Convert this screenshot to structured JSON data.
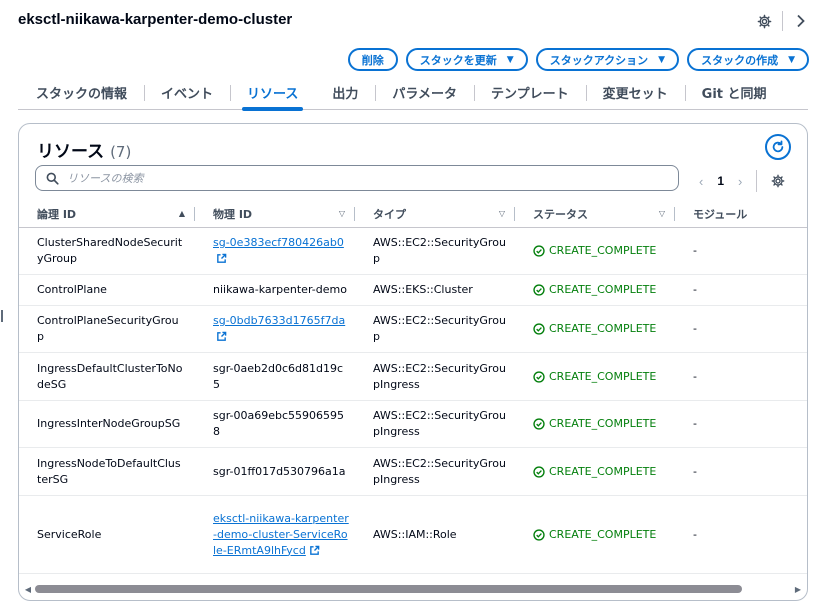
{
  "stack": {
    "title": "eksctl-niikawa-karpenter-demo-cluster"
  },
  "actions": [
    {
      "label": "削除",
      "dropdown": false
    },
    {
      "label": "スタックを更新",
      "dropdown": true
    },
    {
      "label": "スタックアクション",
      "dropdown": true
    },
    {
      "label": "スタックの作成",
      "dropdown": true
    }
  ],
  "tabs": [
    {
      "label": "スタックの情報",
      "active": false
    },
    {
      "label": "イベント",
      "active": false
    },
    {
      "label": "リソース",
      "active": true
    },
    {
      "label": "出力",
      "active": false
    },
    {
      "label": "パラメータ",
      "active": false
    },
    {
      "label": "テンプレート",
      "active": false
    },
    {
      "label": "変更セット",
      "active": false
    },
    {
      "label": "Git と同期",
      "active": false
    }
  ],
  "resources": {
    "title": "リソース",
    "count": "(7)",
    "search_placeholder": "リソースの検索",
    "page": "1",
    "columns": [
      "論理 ID",
      "物理 ID",
      "タイプ",
      "ステータス",
      "モジュール"
    ],
    "rows": [
      {
        "logical_id": "ClusterSharedNodeSecurityGroup",
        "physical_id": "sg-0e383ecf780426ab0",
        "physical_link": true,
        "type": "AWS::EC2::SecurityGroup",
        "status": "CREATE_COMPLETE",
        "module": "-"
      },
      {
        "logical_id": "ControlPlane",
        "physical_id": "niikawa-karpenter-demo",
        "physical_link": false,
        "type": "AWS::EKS::Cluster",
        "status": "CREATE_COMPLETE",
        "module": "-"
      },
      {
        "logical_id": "ControlPlaneSecurityGroup",
        "physical_id": "sg-0bdb7633d1765f7da",
        "physical_link": true,
        "type": "AWS::EC2::SecurityGroup",
        "status": "CREATE_COMPLETE",
        "module": "-"
      },
      {
        "logical_id": "IngressDefaultClusterToNodeSG",
        "physical_id": "sgr-0aeb2d0c6d81d19c5",
        "physical_link": false,
        "type": "AWS::EC2::SecurityGroupIngress",
        "status": "CREATE_COMPLETE",
        "module": "-"
      },
      {
        "logical_id": "IngressInterNodeGroupSG",
        "physical_id": "sgr-00a69ebc559065958",
        "physical_link": false,
        "type": "AWS::EC2::SecurityGroupIngress",
        "status": "CREATE_COMPLETE",
        "module": "-"
      },
      {
        "logical_id": "IngressNodeToDefaultClusterSG",
        "physical_id": "sgr-01ff017d530796a1a",
        "physical_link": false,
        "type": "AWS::EC2::SecurityGroupIngress",
        "status": "CREATE_COMPLETE",
        "module": "-"
      },
      {
        "logical_id": "ServiceRole",
        "physical_id": "eksctl-niikawa-karpenter-demo-cluster-ServiceRole-ERmtA9lhFycd",
        "physical_link": true,
        "type": "AWS::IAM::Role",
        "status": "CREATE_COMPLETE",
        "module": "-"
      }
    ]
  },
  "colors": {
    "accent": "#0972d3",
    "success": "#037f0c",
    "text": "#000716",
    "border": "#b6bec9"
  },
  "icons": {
    "settings": "gear-icon",
    "next": "chevron-right-icon",
    "refresh": "refresh-icon",
    "search": "search-icon",
    "external": "external-link-icon",
    "status": "check-circle-icon"
  }
}
